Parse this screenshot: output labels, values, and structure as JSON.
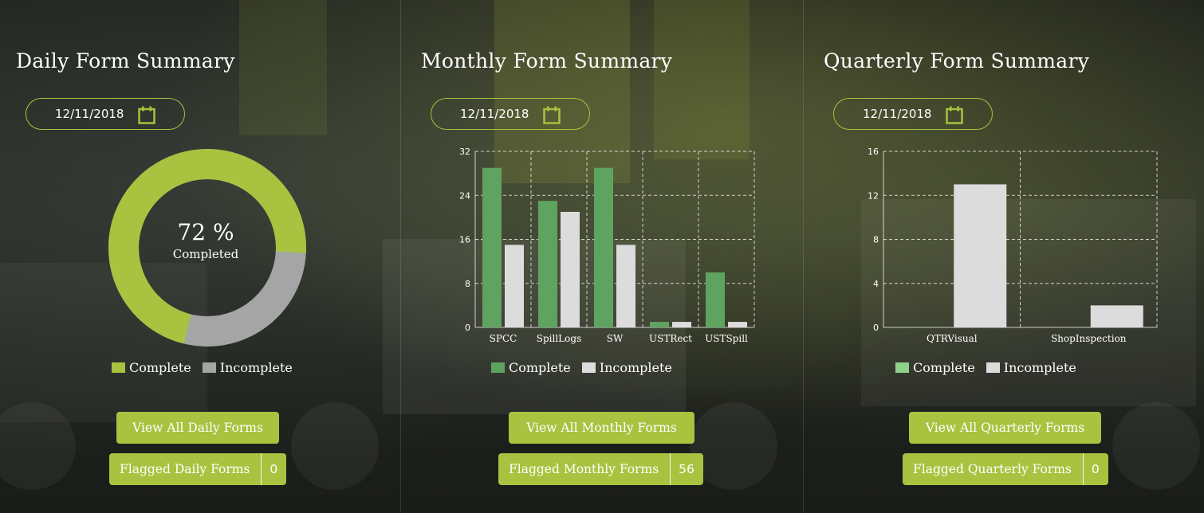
{
  "colors": {
    "accent": "#a9c23f",
    "daily_complete": "#a9c23f",
    "daily_incomplete": "#a5a5a5",
    "monthly_complete": "#5ea35f",
    "incomplete_bar": "#dcdcdc",
    "quarterly_complete": "#8fd18b"
  },
  "icons": {
    "calendar": "calendar-icon"
  },
  "daily": {
    "title": "Daily Form Summary",
    "date": "12/11/2018",
    "percent_label": "72 %",
    "completed_label": "Completed",
    "legend_complete": "Complete",
    "legend_incomplete": "Incomplete",
    "view_button": "View All Daily Forms",
    "flagged_label": "Flagged Daily Forms",
    "flagged_count": "0"
  },
  "monthly": {
    "title": "Monthly Form Summary",
    "date": "12/11/2018",
    "legend_complete": "Complete",
    "legend_incomplete": "Incomplete",
    "view_button": "View All Monthly Forms",
    "flagged_label": "Flagged Monthly Forms",
    "flagged_count": "56"
  },
  "quarterly": {
    "title": "Quarterly Form Summary",
    "date": "12/11/2018",
    "legend_complete": "Complete",
    "legend_incomplete": "Incomplete",
    "view_button": "View All Quarterly Forms",
    "flagged_label": "Flagged Quarterly Forms",
    "flagged_count": "0"
  },
  "chart_data": [
    {
      "type": "pie",
      "title": "Daily Form Summary",
      "categories": [
        "Complete",
        "Incomplete"
      ],
      "values": [
        72,
        28
      ],
      "center_label": "72 %"
    },
    {
      "type": "bar",
      "title": "Monthly Form Summary",
      "categories": [
        "SPCC",
        "SpillLogs",
        "SW",
        "USTRect",
        "USTSpill"
      ],
      "series": [
        {
          "name": "Complete",
          "values": [
            29,
            23,
            29,
            1,
            10
          ]
        },
        {
          "name": "Incomplete",
          "values": [
            15,
            21,
            15,
            1,
            1
          ]
        }
      ],
      "ylim": [
        0,
        32
      ],
      "yticks": [
        0,
        8,
        16,
        24,
        32
      ],
      "grid": true,
      "legend": "bottom"
    },
    {
      "type": "bar",
      "title": "Quarterly Form Summary",
      "categories": [
        "QTRVisual",
        "ShopInspection"
      ],
      "series": [
        {
          "name": "Complete",
          "values": [
            0,
            0
          ]
        },
        {
          "name": "Incomplete",
          "values": [
            13,
            2
          ]
        }
      ],
      "ylim": [
        0,
        16
      ],
      "yticks": [
        0,
        4,
        8,
        12,
        16
      ],
      "grid": true,
      "legend": "bottom"
    }
  ]
}
